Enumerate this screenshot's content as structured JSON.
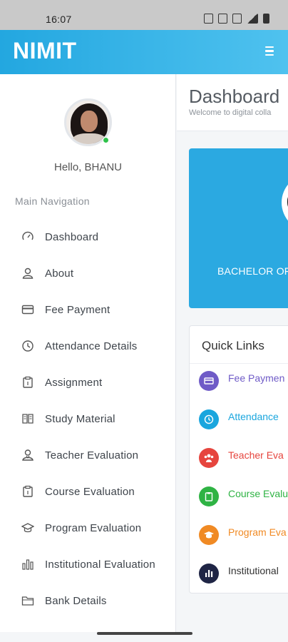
{
  "status_bar": {
    "time": "16:07",
    "icons": [
      "nfc-icon",
      "bluetooth-icon",
      "volte-icon",
      "signal-icon",
      "battery-icon"
    ]
  },
  "app_bar": {
    "brand": "NIMIT",
    "menu_icon": "hamburger-menu-icon"
  },
  "sidebar": {
    "greeting": "Hello, BHANU",
    "nav_heading": "Main Navigation",
    "items": [
      {
        "label": "Dashboard",
        "icon": "speedometer-icon"
      },
      {
        "label": "About",
        "icon": "user-icon"
      },
      {
        "label": "Fee Payment",
        "icon": "credit-card-icon"
      },
      {
        "label": "Attendance Details",
        "icon": "clock-icon"
      },
      {
        "label": "Assignment",
        "icon": "clipboard-icon"
      },
      {
        "label": "Study Material",
        "icon": "book-icon"
      },
      {
        "label": "Teacher Evaluation",
        "icon": "teacher-icon"
      },
      {
        "label": "Course Evaluation",
        "icon": "clipboard-icon"
      },
      {
        "label": "Program Evaluation",
        "icon": "graduation-cap-icon"
      },
      {
        "label": "Institutional Evaluation",
        "icon": "bar-chart-icon"
      },
      {
        "label": "Bank Details",
        "icon": "folder-icon"
      }
    ]
  },
  "main": {
    "title": "Dashboard",
    "subtitle": "Welcome to digital colla",
    "hero": {
      "program_text": "BACHELOR OF",
      "color": "#2ba9e1"
    },
    "quick_links": {
      "title": "Quick Links",
      "items": [
        {
          "label": "Fee Paymen",
          "icon": "credit-card-icon",
          "color": "#6f5bc7"
        },
        {
          "label": "Attendance",
          "icon": "clock-icon",
          "color": "#1aa6de"
        },
        {
          "label": "Teacher Eva",
          "icon": "users-icon",
          "color": "#e6453e"
        },
        {
          "label": "Course Evalu",
          "icon": "clipboard-icon",
          "color": "#2fb344"
        },
        {
          "label": "Program Eva",
          "icon": "graduation-cap-icon",
          "color": "#f08a24"
        },
        {
          "label": "Institutional",
          "icon": "bar-chart-icon",
          "color": "#1f2545"
        }
      ]
    }
  },
  "colors": {
    "appbar": "#23a7e0",
    "online": "#2ec24a"
  }
}
